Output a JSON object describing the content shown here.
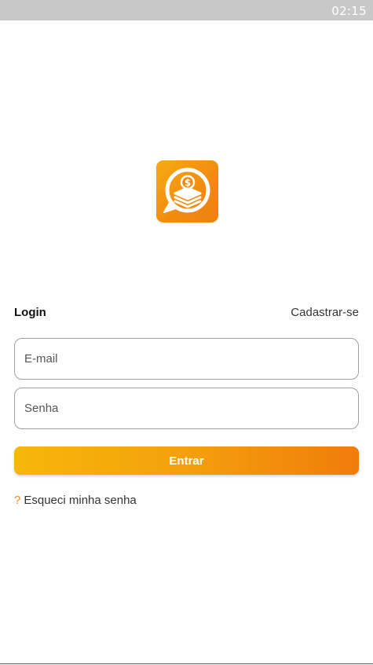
{
  "status_bar": {
    "time": "02:15"
  },
  "logo": {
    "icon": "money-chat-icon",
    "colors": {
      "start": "#f6ab14",
      "end": "#ef7f0f"
    }
  },
  "tabs": {
    "login_label": "Login",
    "signup_label": "Cadastrar-se"
  },
  "form": {
    "email": {
      "placeholder": "E-mail",
      "value": ""
    },
    "password": {
      "placeholder": "Senha",
      "value": ""
    },
    "submit_label": "Entrar",
    "forgot": {
      "icon": "?",
      "label": "Esqueci minha senha"
    }
  },
  "colors": {
    "accent": "#f28a10",
    "button_start": "#f6b70a",
    "button_end": "#f07c0b"
  }
}
